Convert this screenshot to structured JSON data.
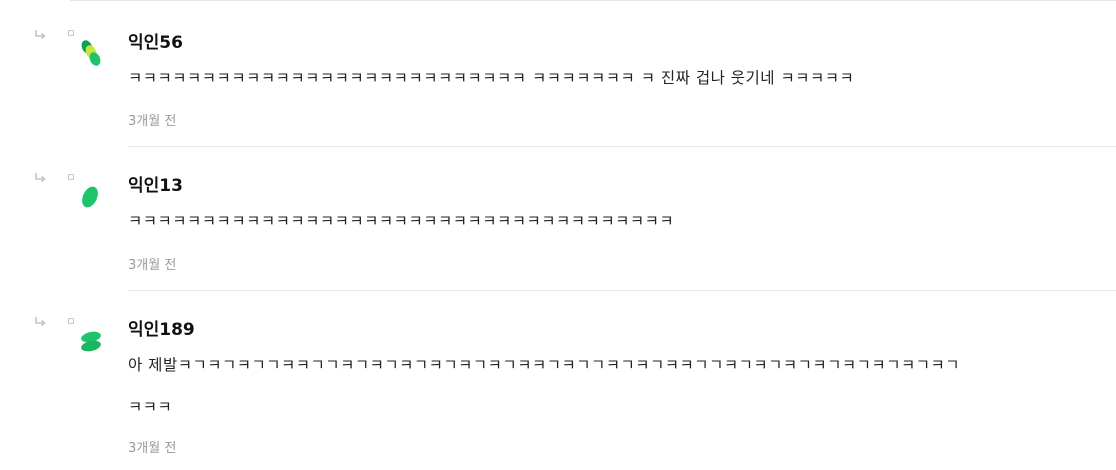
{
  "comments": [
    {
      "author": "익인56",
      "lines": [
        "ㅋㅋㅋㅋㅋㅋㅋㅋㅋㅋㅋㅋㅋㅋㅋㅋㅋㅋㅋㅋㅋㅋㅋㅋㅋㅋㅋ ㅋㅋㅋㅋㅋㅋㅋ ㅋ 진짜 겁나 웃기네 ㅋㅋㅋㅋㅋ"
      ],
      "time": "3개월 전",
      "avatar_icon": "green-leaves-icon",
      "avatar_colors": [
        "#1ec46a",
        "#c9e63a",
        "#0f9e56"
      ]
    },
    {
      "author": "익인13",
      "lines": [
        "ㅋㅋㅋㅋㅋㅋㅋㅋㅋㅋㅋㅋㅋㅋㅋㅋㅋㅋㅋㅋㅋㅋㅋㅋㅋㅋㅋㅋㅋㅋㅋㅋㅋㅋㅋㅋㅋ"
      ],
      "time": "3개월 전",
      "avatar_icon": "green-leaf-icon",
      "avatar_colors": [
        "#1ec46a"
      ]
    },
    {
      "author": "익인189",
      "lines": [
        "아 제발ㅋㄱㅋㄱㅋㄱㄱㅋㅋㄱㄱㅋㄱㅋㄱㅋㄱㅋㄱㅋㄱㅋㄱㅋㅋㄱㅋㄱㄱㅋㄱㅋㄱㅋㅋㄱㄱㅋㄱㅋㄱㅋㄱㅋㄱㅋㄱㅋㄱㅋㄱㅋㄱ",
        "ㅋㅋㅋ"
      ],
      "time": "3개월 전",
      "avatar_icon": "green-stack-icon",
      "avatar_colors": [
        "#1ec46a"
      ]
    }
  ],
  "colors": {
    "accent_green": "#1ec46a",
    "meta_gray": "#9a9a9a",
    "divider": "#e8e8e8"
  }
}
